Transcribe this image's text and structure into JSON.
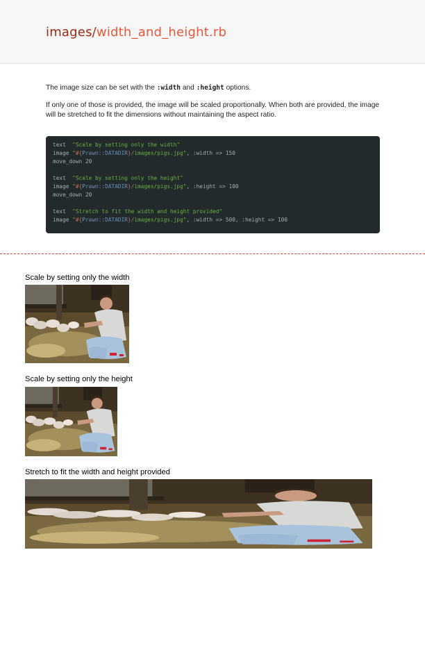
{
  "header": {
    "title_dir": "images/",
    "title_file": "width_and_height.rb"
  },
  "description": {
    "line1_before": "The image size can be set with the ",
    "line1_code1": ":width",
    "line1_mid": " and ",
    "line1_code2": ":height",
    "line1_after": " options.",
    "paragraph2": "If only one of those is provided, the image will be scaled proportionally. When both are provided, the image will be stretched to fit the dimensions without maintaining the aspect ratio."
  },
  "code": {
    "l1_kw": "text  ",
    "l1_str": "\"Scale by setting only the width\"",
    "l2_pre": "image ",
    "l2_q1": "\"",
    "l2_interp_open": "#{",
    "l2_const": "Prawn::DATADIR",
    "l2_interp_close": "}",
    "l2_str": "/images/pigs.jpg\"",
    "l2_rest": ", :width => 150",
    "l3": "move_down 20",
    "l4_kw": "text  ",
    "l4_str": "\"Scale by setting only the height\"",
    "l5_pre": "image ",
    "l5_q1": "\"",
    "l5_interp_open": "#{",
    "l5_const": "Prawn::DATADIR",
    "l5_interp_close": "}",
    "l5_str": "/images/pigs.jpg\"",
    "l5_rest": ", :height => 100",
    "l6": "move_down 20",
    "l7_kw": "text  ",
    "l7_str": "\"Stretch to fit the width and height provided\"",
    "l8_pre": "image ",
    "l8_q1": "\"",
    "l8_interp_open": "#{",
    "l8_const": "Prawn::DATADIR",
    "l8_interp_close": "}",
    "l8_str": "/images/pigs.jpg\"",
    "l8_rest": ", :width => 500, :height => 100"
  },
  "output": {
    "caption1": "Scale by setting only the width",
    "caption2": "Scale by setting only the height",
    "caption3": "Stretch to fit the width and height provided"
  },
  "colors": {
    "title_dir": "#9a2a10",
    "title_file": "#e8573a",
    "code_bg": "#232a2c",
    "code_string": "#6fae43",
    "divider": "#c84a3a"
  }
}
